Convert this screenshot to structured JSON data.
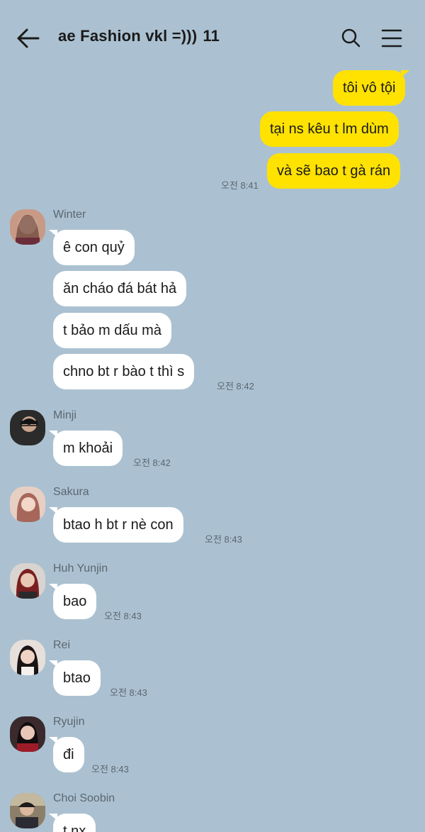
{
  "header": {
    "title": "ae Fashion vkl =)))",
    "member_count": "11",
    "back_icon": "arrow-left-icon",
    "search_icon": "search-icon",
    "menu_icon": "hamburger-menu-icon"
  },
  "colors": {
    "background": "#abc1d1",
    "my_bubble": "#ffe200",
    "their_bubble": "#ffffff"
  },
  "messages": {
    "me": {
      "lines": [
        "tôi vô tội",
        "tại ns kêu t lm dùm",
        "và sẽ bao t gà rán"
      ],
      "time": "오전 8:41"
    },
    "winter": {
      "name": "Winter",
      "lines": [
        "ê con quỷ",
        "ăn cháo đá bát hả",
        "t bảo m dấu mà",
        "chno bt r bào t thì s"
      ],
      "time": "오전 8:42"
    },
    "minji": {
      "name": "Minji",
      "lines": [
        "m khoải"
      ],
      "time": "오전 8:42"
    },
    "sakura": {
      "name": "Sakura",
      "lines": [
        "btao h bt r nè con"
      ],
      "time": "오전 8:43"
    },
    "yunjin": {
      "name": "Huh Yunjin",
      "lines": [
        "bao"
      ],
      "time": "오전 8:43"
    },
    "rei": {
      "name": "Rei",
      "lines": [
        "btao"
      ],
      "time": "오전 8:43"
    },
    "ryujin": {
      "name": "Ryujin",
      "lines": [
        "đi"
      ],
      "time": "오전 8:43"
    },
    "soobin": {
      "name": "Choi Soobin",
      "lines": [
        "t nx"
      ]
    }
  }
}
